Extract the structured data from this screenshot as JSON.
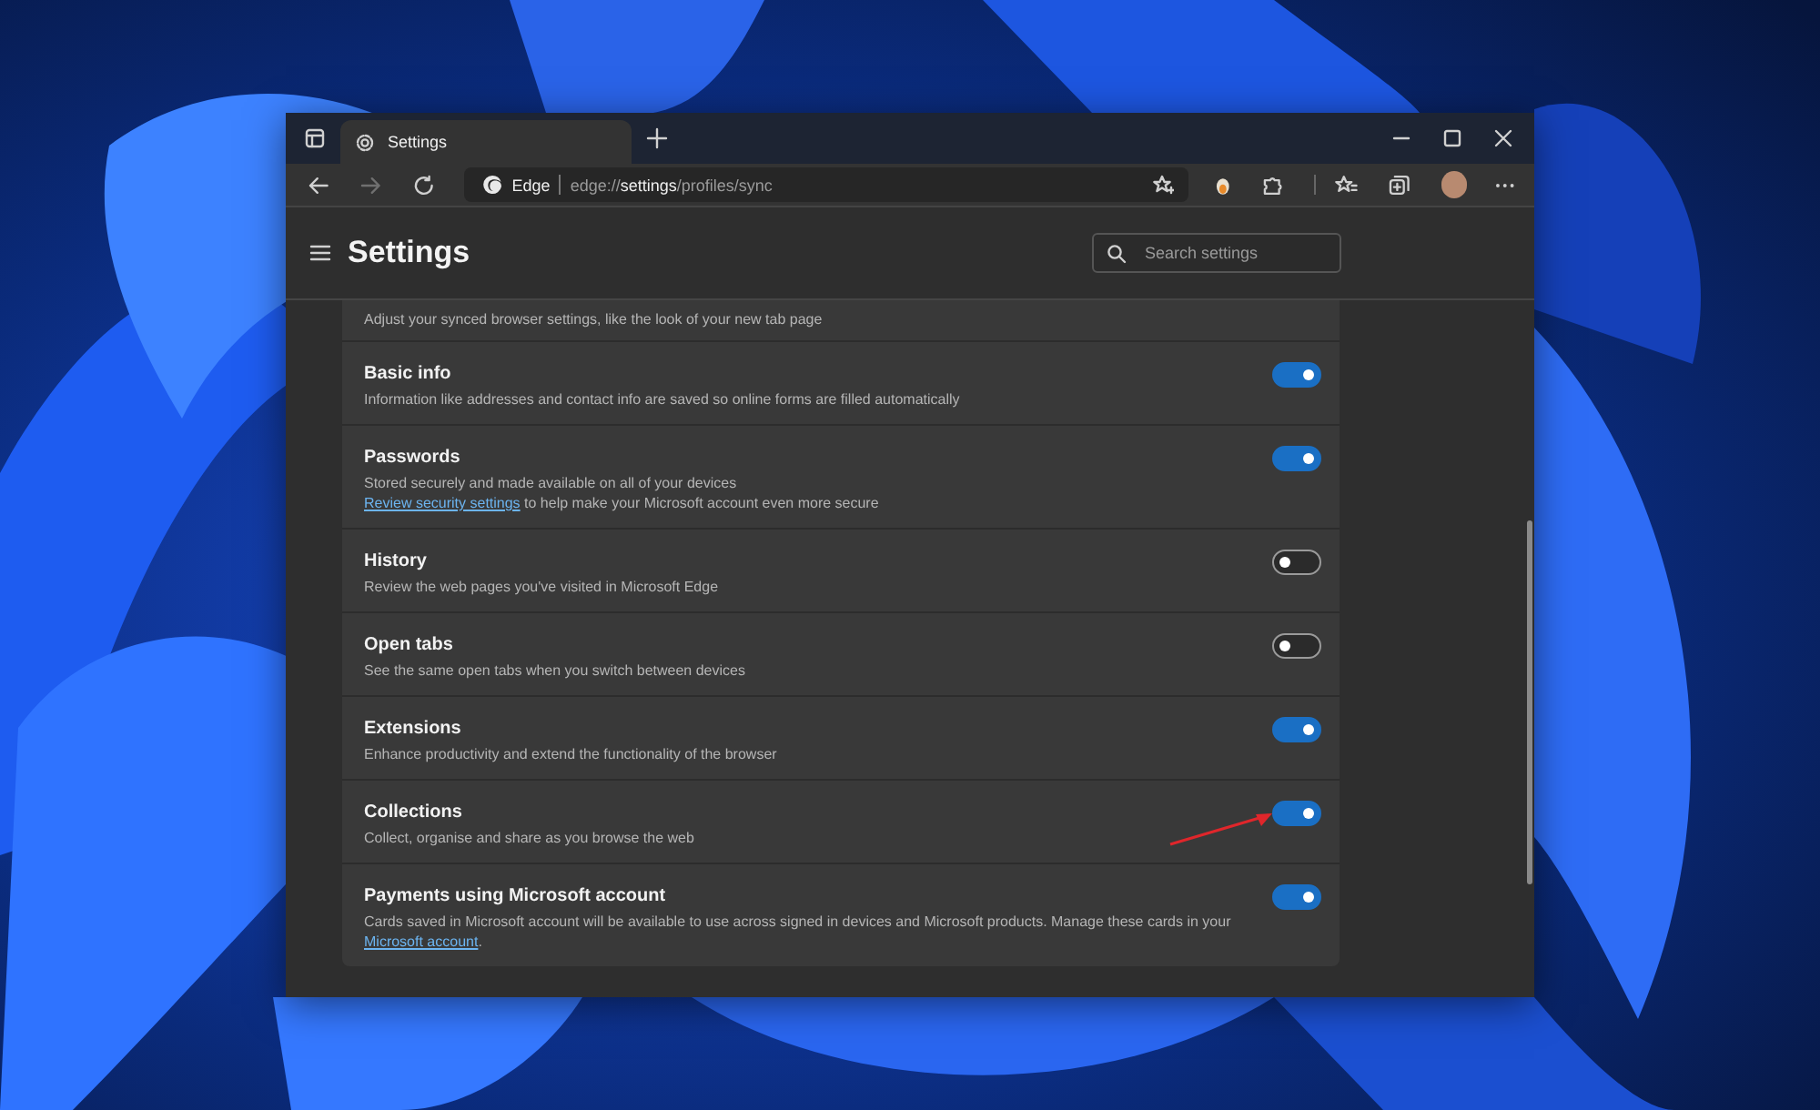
{
  "browser": {
    "tab": {
      "title": "Settings",
      "selected": true
    },
    "nav": {
      "back_disabled": false,
      "forward_disabled": true
    },
    "address": {
      "label": "Edge",
      "url": "edge://**settings**/profiles/sync"
    }
  },
  "settings": {
    "title": "Settings",
    "search": {
      "placeholder": "Search settings"
    },
    "rows": [
      {
        "kind": "partial",
        "description": [
          {
            "kind": "text",
            "text": "Adjust your synced browser settings, like the look of your new tab page"
          }
        ]
      },
      {
        "kind": "toggle",
        "title": "Basic info",
        "on": true,
        "pointed": false,
        "description": [
          {
            "kind": "text",
            "text": "Information like addresses and contact info are saved so online forms are filled automatically"
          }
        ]
      },
      {
        "kind": "toggle",
        "title": "Passwords",
        "on": true,
        "pointed": false,
        "description": [
          {
            "kind": "text",
            "text": "Stored securely and made available on all of your devices"
          },
          {
            "kind": "break"
          },
          {
            "kind": "link",
            "text": "Review security settings"
          },
          {
            "kind": "text",
            "text": " to help make your Microsoft account even more secure"
          }
        ]
      },
      {
        "kind": "toggle",
        "title": "History",
        "on": false,
        "pointed": false,
        "description": [
          {
            "kind": "text",
            "text": "Review the web pages you've visited in Microsoft Edge"
          }
        ]
      },
      {
        "kind": "toggle",
        "title": "Open tabs",
        "on": false,
        "pointed": false,
        "description": [
          {
            "kind": "text",
            "text": "See the same open tabs when you switch between devices"
          }
        ]
      },
      {
        "kind": "toggle",
        "title": "Extensions",
        "on": true,
        "pointed": false,
        "description": [
          {
            "kind": "text",
            "text": "Enhance productivity and extend the functionality of the browser"
          }
        ]
      },
      {
        "kind": "toggle",
        "title": "Collections",
        "on": true,
        "pointed": true,
        "description": [
          {
            "kind": "text",
            "text": "Collect, organise and share as you browse the web"
          }
        ]
      },
      {
        "kind": "toggle",
        "title": "Payments using Microsoft account",
        "on": true,
        "pointed": false,
        "description": [
          {
            "kind": "text",
            "text": "Cards saved in Microsoft account will be available to use across signed in devices and Microsoft products. Manage these cards in your"
          },
          {
            "kind": "break"
          },
          {
            "kind": "link",
            "text": "Microsoft account"
          },
          {
            "kind": "text",
            "text": "."
          }
        ]
      }
    ]
  }
}
